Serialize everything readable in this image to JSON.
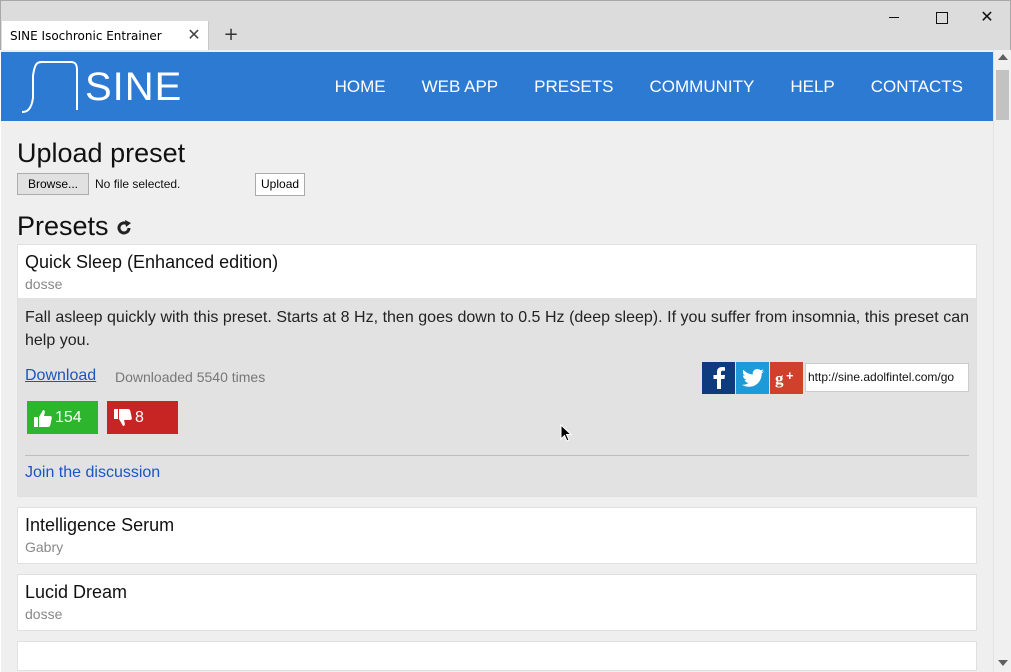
{
  "browser": {
    "tab_title": "SINE Isochronic Entrainer",
    "tab_close": "✕",
    "new_tab": "+",
    "window_close": "✕"
  },
  "site": {
    "logo_text": "SINE",
    "brand_color": "#2d7ad3",
    "nav": [
      "HOME",
      "WEB APP",
      "PRESETS",
      "COMMUNITY",
      "HELP",
      "CONTACTS"
    ]
  },
  "upload": {
    "heading": "Upload preset",
    "browse_label": "Browse...",
    "file_status": "No file selected.",
    "upload_label": "Upload"
  },
  "presets": {
    "heading": "Presets",
    "items": [
      {
        "title": "Quick Sleep (Enhanced edition)",
        "author": "dosse",
        "description": "Fall asleep quickly with this preset. Starts at 8 Hz, then goes down to 0.5 Hz (deep sleep). If you suffer from insomnia, this preset can help you.",
        "download_label": "Download",
        "download_count": "Downloaded 5540 times",
        "share_url": "http://sine.adolfintel.com/go",
        "upvotes": "154",
        "downvotes": "8",
        "discuss_label": "Join the discussion"
      },
      {
        "title": "Intelligence Serum",
        "author": "Gabry"
      },
      {
        "title": "Lucid Dream",
        "author": "dosse"
      }
    ]
  },
  "icons": {
    "facebook": "facebook-icon",
    "twitter": "twitter-icon",
    "googleplus": "google-plus-icon",
    "refresh": "refresh-icon",
    "thumbs_up": "thumbs-up-icon",
    "thumbs_down": "thumbs-down-icon"
  }
}
